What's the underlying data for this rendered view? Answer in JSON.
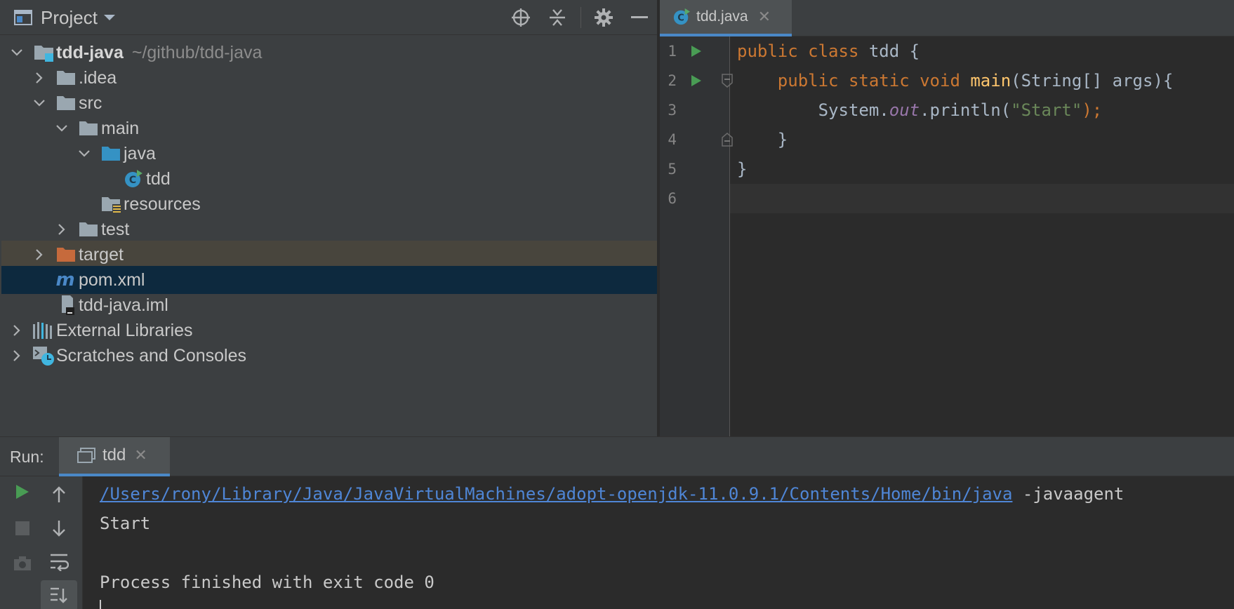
{
  "project_panel": {
    "title": "Project",
    "tree": [
      {
        "label": "tdd-java",
        "path": "~/github/tdd-java"
      },
      {
        "label": ".idea"
      },
      {
        "label": "src"
      },
      {
        "label": "main"
      },
      {
        "label": "java"
      },
      {
        "label": "tdd"
      },
      {
        "label": "resources"
      },
      {
        "label": "test"
      },
      {
        "label": "target"
      },
      {
        "label": "pom.xml"
      },
      {
        "label": "tdd-java.iml"
      },
      {
        "label": "External Libraries"
      },
      {
        "label": "Scratches and Consoles"
      }
    ]
  },
  "editor": {
    "tab_label": "tdd.java",
    "line_numbers": [
      "1",
      "2",
      "3",
      "4",
      "5",
      "6"
    ],
    "code": {
      "l1_kw1": "public",
      "l1_kw2": "class",
      "l1_rest": " tdd {",
      "l2_kw1": "public",
      "l2_kw2": "static",
      "l2_kw3": "void",
      "l2_fn": "main",
      "l2_rest": "(String[] args){",
      "l3_a": "System.",
      "l3_fld": "out",
      "l3_b": ".println(",
      "l3_str": "\"Start\"",
      "l3_end": ");",
      "l4": "}",
      "l5": "}"
    }
  },
  "run_panel": {
    "label": "Run:",
    "tab_label": "tdd",
    "console": {
      "java_path": "/Users/rony/Library/Java/JavaVirtualMachines/adopt-openjdk-11.0.9.1/Contents/Home/bin/java",
      "java_args": " -javaagent",
      "output": "Start",
      "exit": "Process finished with exit code 0"
    }
  },
  "colors": {
    "accent": "#4a88c7",
    "run_green": "#499c54",
    "keyword": "#cc7832",
    "function": "#ffc66d",
    "string": "#6a8759",
    "field": "#9876aa"
  }
}
